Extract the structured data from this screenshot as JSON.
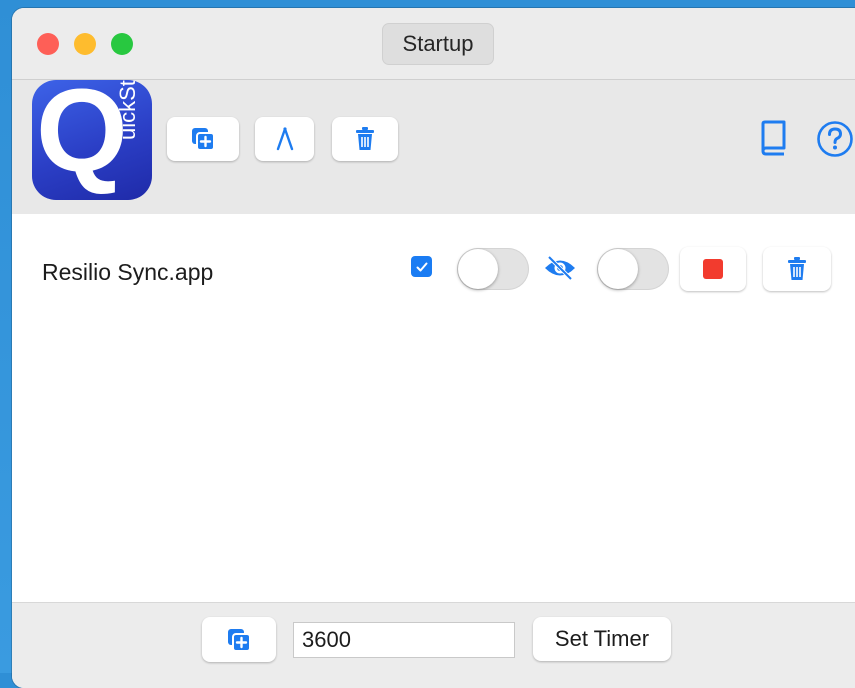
{
  "window": {
    "title": "Startup"
  },
  "toolbar": {
    "logo_letter": "Q",
    "logo_word": "uickStart",
    "icons": [
      "add-copy-icon",
      "compass-icon",
      "trash-icon",
      "book-icon",
      "help-icon"
    ]
  },
  "item": {
    "name": "Resilio Sync.app",
    "checked": true,
    "icons": [
      "eye-slash-icon",
      "stop-icon",
      "trash-icon"
    ]
  },
  "footer": {
    "timer_value": "3600",
    "set_timer_label": "Set Timer"
  },
  "colors": {
    "accent": "#1e7cf0",
    "stop": "#f23b2e"
  }
}
